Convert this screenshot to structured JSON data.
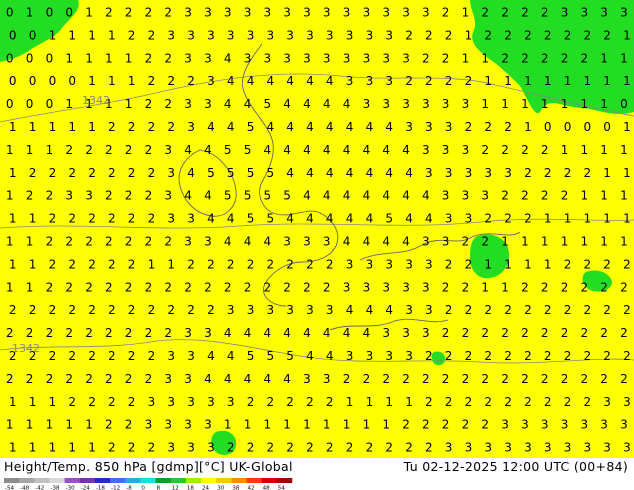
{
  "map": {
    "background_color": "#ffff00",
    "positive_region_color": "#22dd22",
    "contour_color": "#888888",
    "coast_color": "#666666",
    "label_color": "#000000",
    "grid_labels": [
      [
        "0",
        "1",
        "0",
        "0",
        "1",
        "2",
        "2",
        "2",
        "2",
        "3",
        "3",
        "3",
        "3",
        "3",
        "3",
        "3",
        "3",
        "3",
        "3",
        "3",
        "3",
        "3",
        "2",
        "1",
        "2",
        "2",
        "2",
        "2",
        "3",
        "3",
        "3",
        "3"
      ],
      [
        "0",
        "0",
        "1",
        "1",
        "1",
        "1",
        "2",
        "2",
        "3",
        "3",
        "3",
        "3",
        "3",
        "3",
        "3",
        "3",
        "3",
        "3",
        "3",
        "3",
        "2",
        "2",
        "2",
        "1",
        "2",
        "2",
        "2",
        "2",
        "2",
        "2",
        "2",
        "1"
      ],
      [
        "0",
        "0",
        "0",
        "1",
        "1",
        "1",
        "1",
        "2",
        "2",
        "3",
        "3",
        "4",
        "3",
        "3",
        "3",
        "3",
        "3",
        "3",
        "3",
        "3",
        "3",
        "2",
        "2",
        "1",
        "1",
        "2",
        "2",
        "2",
        "2",
        "2",
        "1",
        "1"
      ],
      [
        "0",
        "0",
        "0",
        "0",
        "1",
        "1",
        "1",
        "2",
        "2",
        "2",
        "3",
        "4",
        "4",
        "4",
        "4",
        "4",
        "4",
        "3",
        "3",
        "3",
        "2",
        "2",
        "2",
        "2",
        "1",
        "1",
        "1",
        "1",
        "1",
        "1",
        "1",
        "1"
      ],
      [
        "0",
        "0",
        "0",
        "1",
        "1",
        "1",
        "1",
        "2",
        "2",
        "3",
        "3",
        "4",
        "4",
        "5",
        "4",
        "4",
        "4",
        "4",
        "3",
        "3",
        "3",
        "3",
        "3",
        "3",
        "1",
        "1",
        "1",
        "1",
        "1",
        "1",
        "1",
        "0"
      ],
      [
        "1",
        "1",
        "1",
        "1",
        "1",
        "2",
        "2",
        "2",
        "2",
        "3",
        "4",
        "4",
        "5",
        "4",
        "4",
        "4",
        "4",
        "4",
        "4",
        "4",
        "3",
        "3",
        "3",
        "2",
        "2",
        "2",
        "1",
        "0",
        "0",
        "0",
        "0",
        "1"
      ],
      [
        "1",
        "1",
        "1",
        "2",
        "2",
        "2",
        "2",
        "2",
        "3",
        "4",
        "4",
        "5",
        "5",
        "4",
        "4",
        "4",
        "4",
        "4",
        "4",
        "4",
        "4",
        "3",
        "3",
        "3",
        "2",
        "2",
        "2",
        "2",
        "1",
        "1",
        "1",
        "1"
      ],
      [
        "1",
        "2",
        "2",
        "2",
        "2",
        "2",
        "2",
        "2",
        "3",
        "4",
        "5",
        "5",
        "5",
        "5",
        "4",
        "4",
        "4",
        "4",
        "4",
        "4",
        "4",
        "3",
        "3",
        "3",
        "3",
        "3",
        "2",
        "2",
        "2",
        "2",
        "1",
        "1"
      ],
      [
        "1",
        "2",
        "2",
        "3",
        "3",
        "2",
        "2",
        "2",
        "3",
        "4",
        "4",
        "5",
        "5",
        "5",
        "5",
        "4",
        "4",
        "4",
        "4",
        "4",
        "4",
        "4",
        "3",
        "3",
        "3",
        "2",
        "2",
        "2",
        "2",
        "1",
        "1",
        "1"
      ],
      [
        "1",
        "1",
        "2",
        "2",
        "2",
        "2",
        "2",
        "2",
        "3",
        "3",
        "4",
        "4",
        "5",
        "5",
        "4",
        "4",
        "4",
        "4",
        "4",
        "5",
        "4",
        "4",
        "3",
        "3",
        "2",
        "2",
        "2",
        "1",
        "1",
        "1",
        "1",
        "1"
      ],
      [
        "1",
        "1",
        "2",
        "2",
        "2",
        "2",
        "2",
        "2",
        "2",
        "3",
        "3",
        "4",
        "4",
        "4",
        "3",
        "3",
        "3",
        "4",
        "4",
        "4",
        "4",
        "3",
        "3",
        "2",
        "2",
        "1",
        "1",
        "1",
        "1",
        "1",
        "1",
        "1"
      ],
      [
        "1",
        "1",
        "2",
        "2",
        "2",
        "2",
        "2",
        "1",
        "1",
        "2",
        "2",
        "2",
        "2",
        "2",
        "2",
        "2",
        "2",
        "3",
        "3",
        "3",
        "3",
        "3",
        "2",
        "2",
        "1",
        "1",
        "1",
        "1",
        "2",
        "2",
        "2",
        "2"
      ],
      [
        "1",
        "1",
        "2",
        "2",
        "2",
        "2",
        "2",
        "2",
        "2",
        "2",
        "2",
        "2",
        "2",
        "2",
        "2",
        "2",
        "2",
        "3",
        "3",
        "3",
        "3",
        "3",
        "2",
        "2",
        "1",
        "1",
        "2",
        "2",
        "2",
        "2",
        "2",
        "2"
      ],
      [
        "2",
        "2",
        "2",
        "2",
        "2",
        "2",
        "2",
        "2",
        "2",
        "2",
        "2",
        "3",
        "3",
        "3",
        "3",
        "3",
        "3",
        "4",
        "4",
        "4",
        "3",
        "3",
        "2",
        "2",
        "2",
        "2",
        "2",
        "2",
        "2",
        "2",
        "2",
        "2"
      ],
      [
        "2",
        "2",
        "2",
        "2",
        "2",
        "2",
        "2",
        "2",
        "2",
        "3",
        "3",
        "4",
        "4",
        "4",
        "4",
        "4",
        "4",
        "4",
        "4",
        "3",
        "3",
        "3",
        "2",
        "2",
        "2",
        "2",
        "2",
        "2",
        "2",
        "2",
        "2",
        "2"
      ],
      [
        "2",
        "2",
        "2",
        "2",
        "2",
        "2",
        "2",
        "2",
        "3",
        "3",
        "4",
        "4",
        "5",
        "5",
        "5",
        "4",
        "4",
        "3",
        "3",
        "3",
        "3",
        "2",
        "2",
        "2",
        "2",
        "2",
        "2",
        "2",
        "2",
        "2",
        "2",
        "2"
      ],
      [
        "2",
        "2",
        "2",
        "2",
        "2",
        "2",
        "2",
        "2",
        "3",
        "3",
        "4",
        "4",
        "4",
        "4",
        "4",
        "3",
        "3",
        "2",
        "2",
        "2",
        "2",
        "2",
        "2",
        "2",
        "2",
        "2",
        "2",
        "2",
        "2",
        "2",
        "2",
        "2"
      ],
      [
        "1",
        "1",
        "1",
        "2",
        "2",
        "2",
        "2",
        "3",
        "3",
        "3",
        "3",
        "3",
        "2",
        "2",
        "2",
        "2",
        "2",
        "1",
        "1",
        "1",
        "1",
        "2",
        "2",
        "2",
        "2",
        "2",
        "2",
        "2",
        "2",
        "2",
        "3",
        "3"
      ],
      [
        "1",
        "1",
        "1",
        "1",
        "1",
        "2",
        "2",
        "3",
        "3",
        "3",
        "3",
        "1",
        "1",
        "1",
        "1",
        "1",
        "1",
        "1",
        "1",
        "1",
        "2",
        "2",
        "2",
        "2",
        "2",
        "3",
        "3",
        "3",
        "3",
        "3",
        "3",
        "3"
      ],
      [
        "1",
        "1",
        "1",
        "1",
        "1",
        "2",
        "2",
        "2",
        "3",
        "3",
        "3",
        "2",
        "2",
        "2",
        "2",
        "2",
        "2",
        "2",
        "2",
        "2",
        "2",
        "2",
        "3",
        "3",
        "3",
        "3",
        "3",
        "3",
        "3",
        "3",
        "3",
        "3"
      ]
    ],
    "contour_labels": [
      "1342",
      "1342"
    ]
  },
  "footer": {
    "left_text": "Height/Temp. 850 hPa [gdmp][°C] UK-Global",
    "right_text": "Tu 02-12-2025 12:00 UTC (00+84)",
    "colorbar": {
      "ticks": [
        "-54",
        "-48",
        "-42",
        "-38",
        "-30",
        "-24",
        "-18",
        "-12",
        "-8",
        "0",
        "8",
        "12",
        "18",
        "24",
        "30",
        "38",
        "42",
        "48",
        "54"
      ],
      "colors": [
        "#8c8c8c",
        "#a6a6a6",
        "#c0c0c0",
        "#d9d9d9",
        "#9a4fd0",
        "#7a2fb8",
        "#2929c8",
        "#3f6ff0",
        "#2aa8f0",
        "#1edcdc",
        "#0aa028",
        "#28c828",
        "#a0f000",
        "#ffff00",
        "#ffc800",
        "#ff8c00",
        "#ff3c00",
        "#d20000",
        "#a00000"
      ]
    }
  }
}
